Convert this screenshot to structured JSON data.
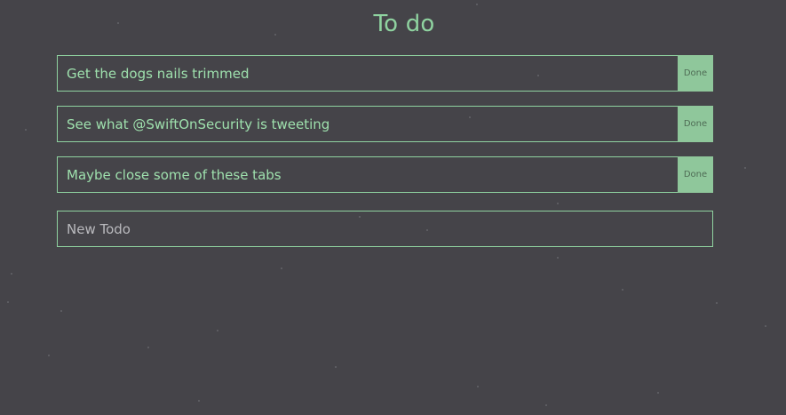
{
  "header": {
    "title": "To do"
  },
  "todos": [
    {
      "text": "Get the dogs nails trimmed",
      "action_label": "Done"
    },
    {
      "text": "See what @SwiftOnSecurity is tweeting",
      "action_label": "Done"
    },
    {
      "text": "Maybe close some of these tabs",
      "action_label": "Done"
    }
  ],
  "new_todo": {
    "placeholder": "New Todo",
    "value": ""
  },
  "colors": {
    "background": "#454449",
    "accent": "#8fd3a0",
    "done_button_bg": "#8fc79b"
  }
}
